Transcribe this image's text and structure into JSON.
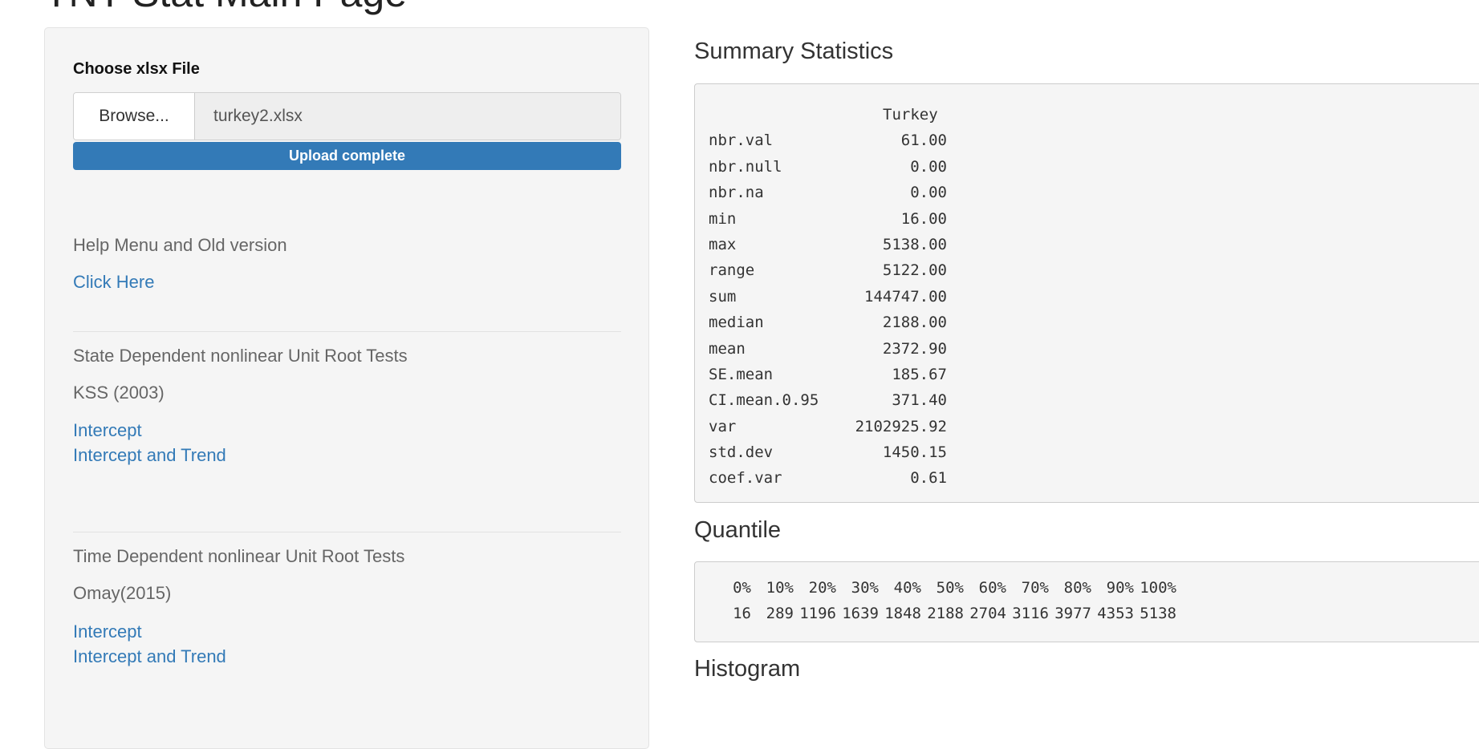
{
  "page": {
    "title": "TNT Stat Main Page"
  },
  "sidebar": {
    "file_input": {
      "label": "Choose xlsx File",
      "browse_label": "Browse...",
      "file_name": "turkey2.xlsx",
      "progress_label": "Upload complete",
      "progress_fraction": 1.0
    },
    "help_text": "Help Menu and Old version",
    "help_link": "Click Here",
    "state_dependent": {
      "heading": "State Dependent nonlinear Unit Root Tests",
      "model": "KSS (2003)",
      "links": [
        "Intercept",
        "Intercept and Trend"
      ]
    },
    "time_dependent": {
      "heading": "Time Dependent nonlinear Unit Root Tests",
      "model": "Omay(2015)",
      "links": [
        "Intercept",
        "Intercept and Trend"
      ]
    }
  },
  "main": {
    "summary": {
      "heading": "Summary Statistics",
      "column": "Turkey",
      "rows": [
        {
          "key": "nbr.val",
          "value": "61.00"
        },
        {
          "key": "nbr.null",
          "value": "0.00"
        },
        {
          "key": "nbr.na",
          "value": "0.00"
        },
        {
          "key": "min",
          "value": "16.00"
        },
        {
          "key": "max",
          "value": "5138.00"
        },
        {
          "key": "range",
          "value": "5122.00"
        },
        {
          "key": "sum",
          "value": "144747.00"
        },
        {
          "key": "median",
          "value": "2188.00"
        },
        {
          "key": "mean",
          "value": "2372.90"
        },
        {
          "key": "SE.mean",
          "value": "185.67"
        },
        {
          "key": "CI.mean.0.95",
          "value": "371.40"
        },
        {
          "key": "var",
          "value": "2102925.92"
        },
        {
          "key": "std.dev",
          "value": "1450.15"
        },
        {
          "key": "coef.var",
          "value": "0.61"
        }
      ]
    },
    "quantile": {
      "heading": "Quantile",
      "labels": [
        "0%",
        "10%",
        "20%",
        "30%",
        "40%",
        "50%",
        "60%",
        "70%",
        "80%",
        "90%",
        "100%"
      ],
      "values": [
        "16",
        "289",
        "1196",
        "1639",
        "1848",
        "2188",
        "2704",
        "3116",
        "3977",
        "4353",
        "5138"
      ]
    },
    "histogram": {
      "heading": "Histogram"
    }
  }
}
